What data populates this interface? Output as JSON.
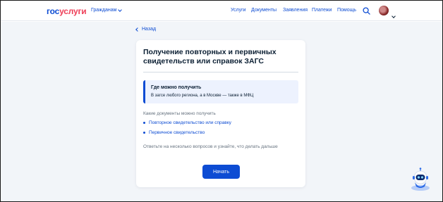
{
  "header": {
    "logo_part1": "гос",
    "logo_part2": "услуги",
    "audience": "Гражданам",
    "nav": [
      "Услуги",
      "Документы",
      "Заявления",
      "Платежи",
      "Помощь"
    ]
  },
  "back_label": "Назад",
  "card": {
    "title": "Получение повторных и первичных свидетельств или справок ЗАГС",
    "info_title": "Где можно получить",
    "info_text": "В загсе любого региона, а в Москве — также в МФЦ",
    "docs_question": "Какие документы можно получить",
    "options": [
      "Повторное свидетельство или справку",
      "Первичное свидетельство"
    ],
    "hint": "Ответьте на несколько вопросов и узнайте, что делать дальше",
    "start_button": "Начать"
  },
  "colors": {
    "brand_blue": "#0d4cd3",
    "brand_red": "#ee3f58",
    "page_bg": "#f2f5f9",
    "info_bg": "#edf2fe"
  },
  "icons": [
    "chevron-down-icon",
    "search-icon",
    "avatar",
    "chevron-left-icon",
    "robot-assistant-icon"
  ]
}
